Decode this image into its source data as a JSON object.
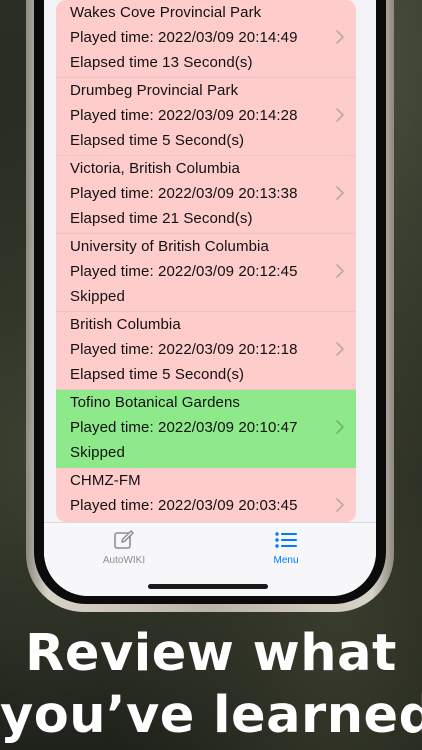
{
  "history": {
    "items": [
      {
        "title": "Wakes Cove Provincial Park",
        "played": "Played time:  2022/03/09 20:14:49",
        "status": "Elapsed time 13 Second(s)",
        "color": "#ffcccc"
      },
      {
        "title": "Drumbeg Provincial Park",
        "played": "Played time:  2022/03/09 20:14:28",
        "status": "Elapsed time 5 Second(s)",
        "color": "#ffcccc"
      },
      {
        "title": "Victoria, British Columbia",
        "played": "Played time:  2022/03/09 20:13:38",
        "status": "Elapsed time 21 Second(s)",
        "color": "#ffcccc"
      },
      {
        "title": "University of British Columbia",
        "played": "Played time:  2022/03/09 20:12:45",
        "status": "Skipped",
        "color": "#ffcccc"
      },
      {
        "title": "British Columbia",
        "played": "Played time:  2022/03/09 20:12:18",
        "status": "Elapsed time 5 Second(s)",
        "color": "#ffcccc"
      },
      {
        "title": "Tofino Botanical Gardens",
        "played": "Played time:  2022/03/09 20:10:47",
        "status": "Skipped",
        "color": "#8ee98b"
      },
      {
        "title": "CHMZ-FM",
        "played": "Played time:  2022/03/09 20:03:45",
        "status": "",
        "color": "#ffcccc"
      }
    ]
  },
  "tabbar": {
    "autowiki_label": "AutoWIKI",
    "autowiki_icon": "compose-icon",
    "menu_label": "Menu",
    "menu_icon": "list-icon",
    "active_color": "#007aff",
    "inactive_color": "#8e8e93"
  },
  "caption": {
    "line1": "Review what",
    "line2": "you’ve learned"
  }
}
